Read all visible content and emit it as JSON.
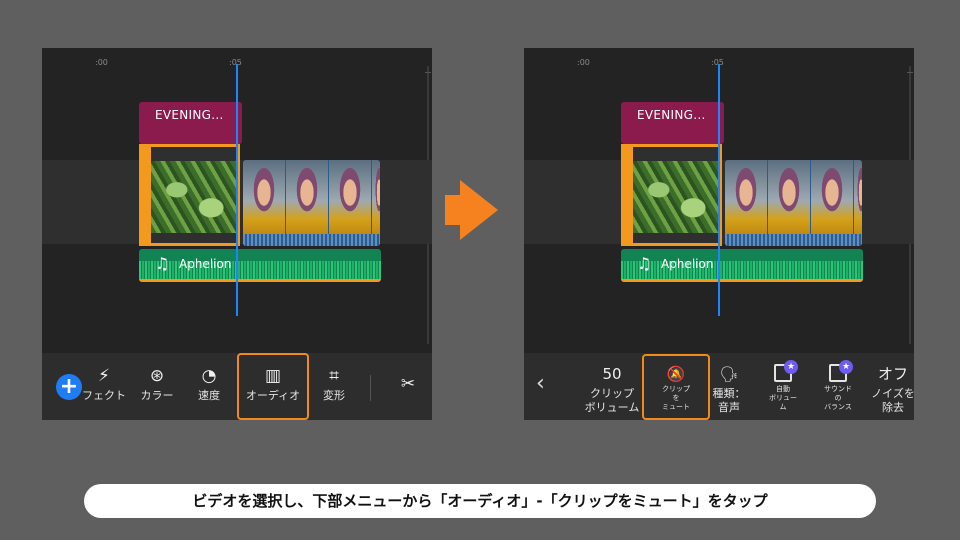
{
  "ruler": {
    "t0": ":00",
    "t5": ":05"
  },
  "timeline": {
    "title_clip": "EVENING...",
    "audio_clip": "Aphelion"
  },
  "left_toolbar": {
    "effects_label": "フェクト",
    "color_label": "カラー",
    "speed_label": "速度",
    "audio_label": "オーディオ",
    "transform_label": "変形"
  },
  "right_toolbar": {
    "volume_value": "50",
    "volume_label_1": "クリップ",
    "volume_label_2": "ボリューム",
    "mute_label_1": "クリップ",
    "mute_label_2": "を",
    "mute_label_3": "ミュート",
    "type_label_1": "種類：",
    "type_label_2": "音声",
    "auto_label_1": "自動",
    "auto_label_2": "ボリュー",
    "auto_label_3": "ム",
    "balance_label_1": "サウンド",
    "balance_label_2": "の",
    "balance_label_3": "バランス",
    "noise_value": "オフ",
    "noise_label_1": "ノイズを",
    "noise_label_2": "除去"
  },
  "caption": "ビデオを選択し、下部メニューから「オーディオ」-「クリップをミュート」をタップ",
  "colors": {
    "accent": "#f08a1c",
    "playhead": "#1a86ff",
    "title_clip": "#8b1b4d",
    "audio_clip": "#128352",
    "add_button": "#1f7cf2"
  },
  "icons": [
    "effects-icon",
    "color-icon",
    "speed-icon",
    "audio-icon",
    "transform-icon",
    "scissors-icon",
    "back-icon",
    "mute-icon",
    "voice-icon",
    "star-icon",
    "music-note-icon"
  ]
}
